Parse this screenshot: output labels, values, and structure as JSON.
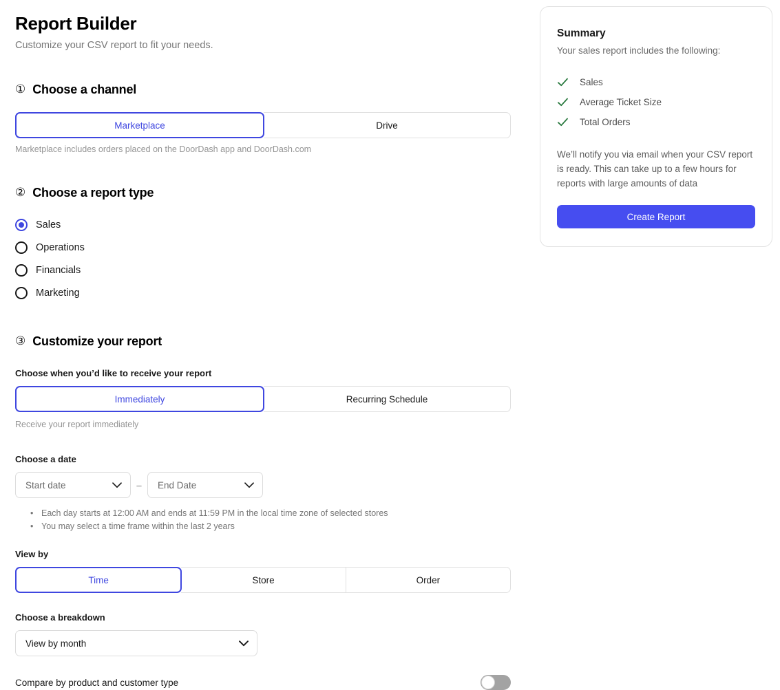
{
  "header": {
    "title": "Report Builder",
    "subtitle": "Customize your CSV report to fit your needs."
  },
  "steps": {
    "channel": {
      "number": "①",
      "title": "Choose a channel",
      "options": [
        {
          "label": "Marketplace",
          "selected": true
        },
        {
          "label": "Drive",
          "selected": false
        }
      ],
      "help": "Marketplace includes orders placed on the DoorDash app and DoorDash.com"
    },
    "report_type": {
      "number": "②",
      "title": "Choose a report type",
      "options": [
        {
          "label": "Sales",
          "selected": true
        },
        {
          "label": "Operations",
          "selected": false
        },
        {
          "label": "Financials",
          "selected": false
        },
        {
          "label": "Marketing",
          "selected": false
        }
      ]
    },
    "customize": {
      "number": "③",
      "title": "Customize your report",
      "delivery_label": "Choose when you’d like to receive your report",
      "delivery_options": [
        {
          "label": "Immediately",
          "selected": true
        },
        {
          "label": "Recurring Schedule",
          "selected": false
        }
      ],
      "delivery_help": "Receive your report immediately",
      "date_label": "Choose a date",
      "start_date_placeholder": "Start date",
      "end_date_placeholder": "End Date",
      "date_separator": "–",
      "date_notes": [
        "Each day starts at 12:00 AM and ends at 11:59 PM in the local time zone of selected stores",
        "You may select a time frame within the last 2 years"
      ],
      "view_by_label": "View by",
      "view_by_options": [
        {
          "label": "Time",
          "selected": true
        },
        {
          "label": "Store",
          "selected": false
        },
        {
          "label": "Order",
          "selected": false
        }
      ],
      "breakdown_label": "Choose a breakdown",
      "breakdown_value": "View by month",
      "compare_label": "Compare by product and customer type",
      "compare_enabled": false
    }
  },
  "summary": {
    "title": "Summary",
    "subtitle": "Your sales report includes the following:",
    "items": [
      {
        "label": "Sales"
      },
      {
        "label": "Average Ticket Size"
      },
      {
        "label": "Total Orders"
      }
    ],
    "note": "We’ll notify you via email when your CSV report is ready. This can take up to a few hours for reports with large amounts of data",
    "cta_label": "Create Report"
  },
  "colors": {
    "accent": "#3f47e0",
    "primary_button": "#464df0",
    "check_green": "#2b7a40",
    "toggle_off": "#a3a3a3"
  }
}
